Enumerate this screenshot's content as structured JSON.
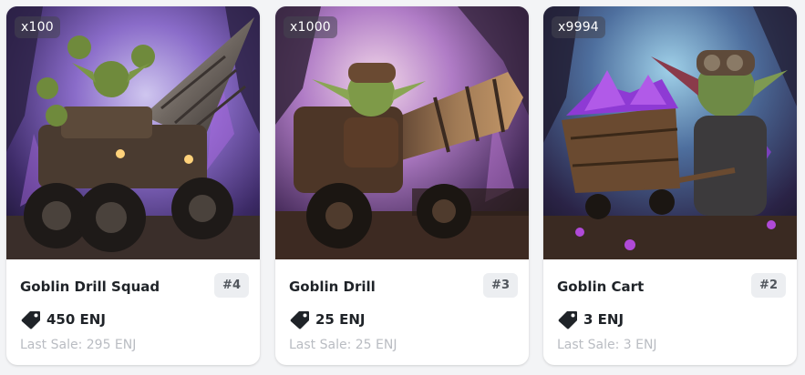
{
  "colors": {
    "card_background": "#ffffff",
    "page_background": "#f3f4f6",
    "title_text": "#1f2328",
    "muted_text": "#b9bcc2",
    "rank_background": "#eceef1",
    "scene_purple": "#7a3fb0"
  },
  "icons": {
    "price": "price-tag-icon"
  },
  "cards": [
    {
      "quantity": "x100",
      "name": "Goblin Drill Squad",
      "rank": "#4",
      "price": "450 ENJ",
      "last_sale": "Last Sale: 295 ENJ",
      "image": "goblin squad riding drill vehicle in a crystal cave"
    },
    {
      "quantity": "x1000",
      "name": "Goblin Drill",
      "rank": "#3",
      "price": "25 ENJ",
      "last_sale": "Last Sale: 25 ENJ",
      "image": "goblin driving a large drill machine"
    },
    {
      "quantity": "x9994",
      "name": "Goblin Cart",
      "rank": "#2",
      "price": "3 ENJ",
      "last_sale": "Last Sale: 3 ENJ",
      "image": "goblin pushing a mine cart full of purple crystals"
    }
  ]
}
